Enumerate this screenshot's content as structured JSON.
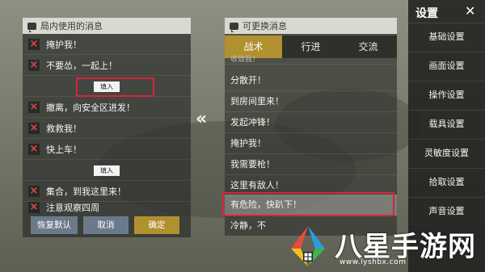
{
  "left_panel": {
    "title": "局内使用的消息",
    "messages": [
      {
        "text": "掩护我！"
      },
      {
        "text": "不要怂，一起上！"
      },
      {
        "text": "撤离，向安全区进发！"
      },
      {
        "text": "救救我！"
      },
      {
        "text": "快上车！"
      },
      {
        "text": "集合，到我这里来！"
      },
      {
        "text": "注意观察四周"
      }
    ],
    "fill_label": "填入",
    "buttons": {
      "reset": "恢复默认",
      "cancel": "取消",
      "confirm": "确定"
    }
  },
  "transfer_arrow": "«",
  "right_panel": {
    "title": "可更换消息",
    "tabs": [
      {
        "label": "战术",
        "active": true
      },
      {
        "label": "行进",
        "active": false
      },
      {
        "label": "交流",
        "active": false
      }
    ],
    "items": [
      {
        "text": "收敛我！"
      },
      {
        "text": "分散开！"
      },
      {
        "text": "到房间里来！"
      },
      {
        "text": "发起冲锋！"
      },
      {
        "text": "掩护我！"
      },
      {
        "text": "我需要枪！"
      },
      {
        "text": "这里有敌人！"
      },
      {
        "text": "有危险，快趴下！"
      },
      {
        "text": "冷静，不"
      }
    ]
  },
  "settings": {
    "title": "设置",
    "close_icon": "close-icon",
    "items": [
      "基础设置",
      "画面设置",
      "操作设置",
      "载具设置",
      "灵敏度设置",
      "拾取设置",
      "声音设置"
    ]
  },
  "watermark": {
    "name": "八星手游网",
    "url": "www.lyshbx.com"
  },
  "colors": {
    "accent_gold": "#b1902f",
    "highlight_red": "#d5263a",
    "delete_red": "#e34848"
  }
}
